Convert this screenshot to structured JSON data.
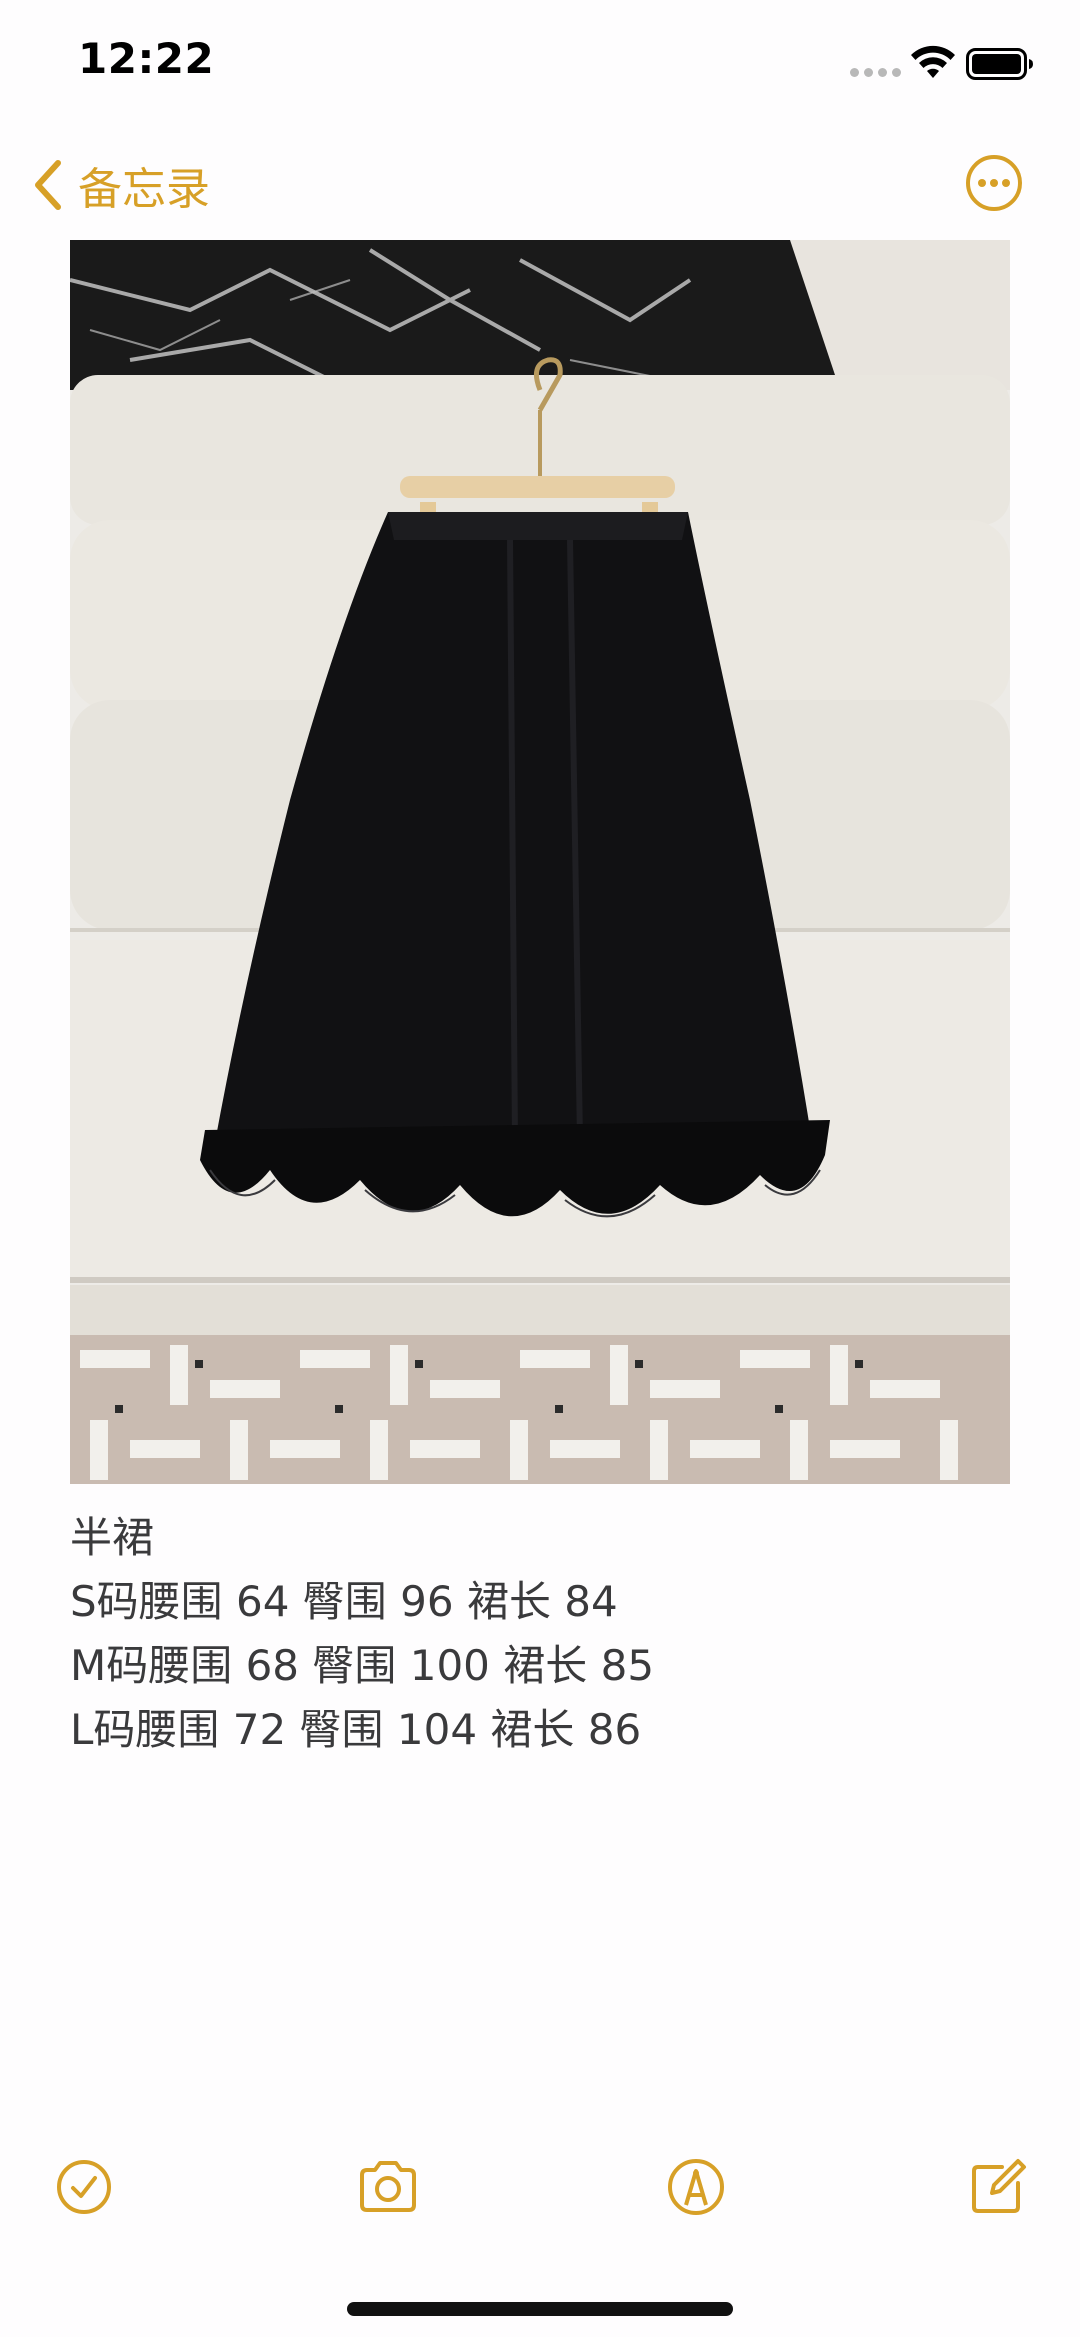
{
  "status_bar": {
    "time": "12:22"
  },
  "nav": {
    "back_label": "备忘录",
    "accent_color": "#D7A027"
  },
  "note": {
    "image_icon": "photo-skirt-on-hanger",
    "lines": [
      "半裙",
      "S码腰围 64 臀围 96 裙长 84",
      "M码腰围 68 臀围 100 裙长 85",
      "L码腰围 72 臀围 104 裙长 86"
    ]
  },
  "toolbar": {
    "items": [
      {
        "icon": "checklist-icon"
      },
      {
        "icon": "camera-icon"
      },
      {
        "icon": "markup-pen-icon"
      },
      {
        "icon": "compose-icon"
      }
    ]
  }
}
